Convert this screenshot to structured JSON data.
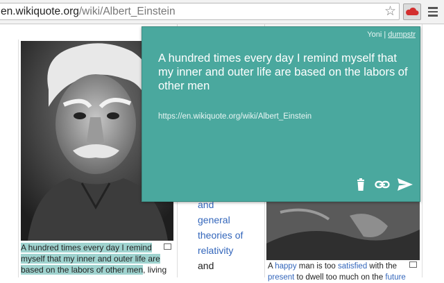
{
  "browser": {
    "url_host": "en.wikiquote.org",
    "url_path": "/wiki/Albert_Einstein",
    "icons": {
      "bookmark": "star-icon",
      "extension": "cloud-icon",
      "menu": "hamburger-menu-icon"
    }
  },
  "popup": {
    "user_name": "Yoni",
    "separator": "|",
    "user_link": "dumpstr",
    "quote": "A hundred times every day I remind myself that my inner and outer life are based on the labors of other men",
    "url": "https://en.wikiquote.org/wiki/Albert_Einstein",
    "icons": {
      "delete": "trash-icon",
      "link": "link-icon",
      "send": "send-icon"
    },
    "colors": {
      "background": "#4aa89e",
      "text": "#ffffff"
    }
  },
  "page": {
    "left_caption_highlighted_1": "A hundred times every day I remind",
    "left_caption_highlighted_2": "myself that my inner and outer life are",
    "left_caption_highlighted_3": "based on the labors of other men",
    "left_caption_rest": ", living",
    "mid_links": [
      "and",
      "general",
      "theories of",
      "relativity"
    ],
    "mid_text": "and",
    "right_caption": {
      "t1": "A ",
      "l1": "happy",
      "t2": " man is too ",
      "l2": "satisfied",
      "t3": " with the",
      "l3": "present",
      "t4": " to dwell too much on the ",
      "l4": "future"
    },
    "highlight_color": "#9fd3cf",
    "link_color": "#3366bb"
  }
}
